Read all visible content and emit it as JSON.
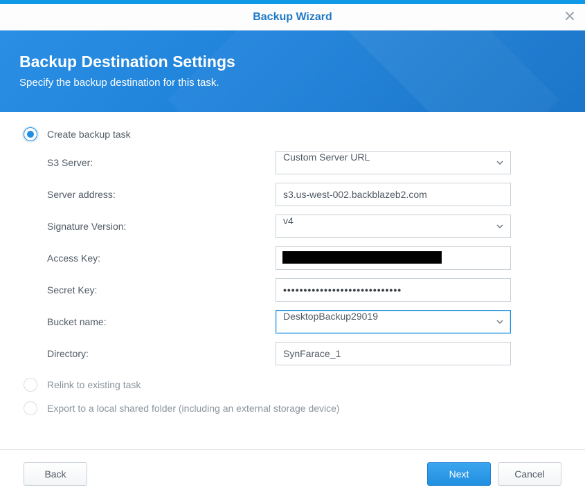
{
  "titlebar": {
    "title": "Backup Wizard"
  },
  "banner": {
    "heading": "Backup Destination Settings",
    "subheading": "Specify the backup destination for this task."
  },
  "options": {
    "create_label": "Create backup task",
    "relink_label": "Relink to existing task",
    "export_label": "Export to a local shared folder (including an external storage device)",
    "selected": "create"
  },
  "form": {
    "s3server": {
      "label": "S3 Server:",
      "value": "Custom Server URL"
    },
    "server_address": {
      "label": "Server address:",
      "value": "s3.us-west-002.backblazeb2.com"
    },
    "sig_version": {
      "label": "Signature Version:",
      "value": "v4"
    },
    "access_key": {
      "label": "Access Key:",
      "value": ""
    },
    "secret_key": {
      "label": "Secret Key:",
      "value": "•••••••••••••••••••••••••••••"
    },
    "bucket": {
      "label": "Bucket name:",
      "value": "DesktopBackup29019"
    },
    "directory": {
      "label": "Directory:",
      "value": "SynFarace_1"
    }
  },
  "footer": {
    "back": "Back",
    "next": "Next",
    "cancel": "Cancel"
  }
}
